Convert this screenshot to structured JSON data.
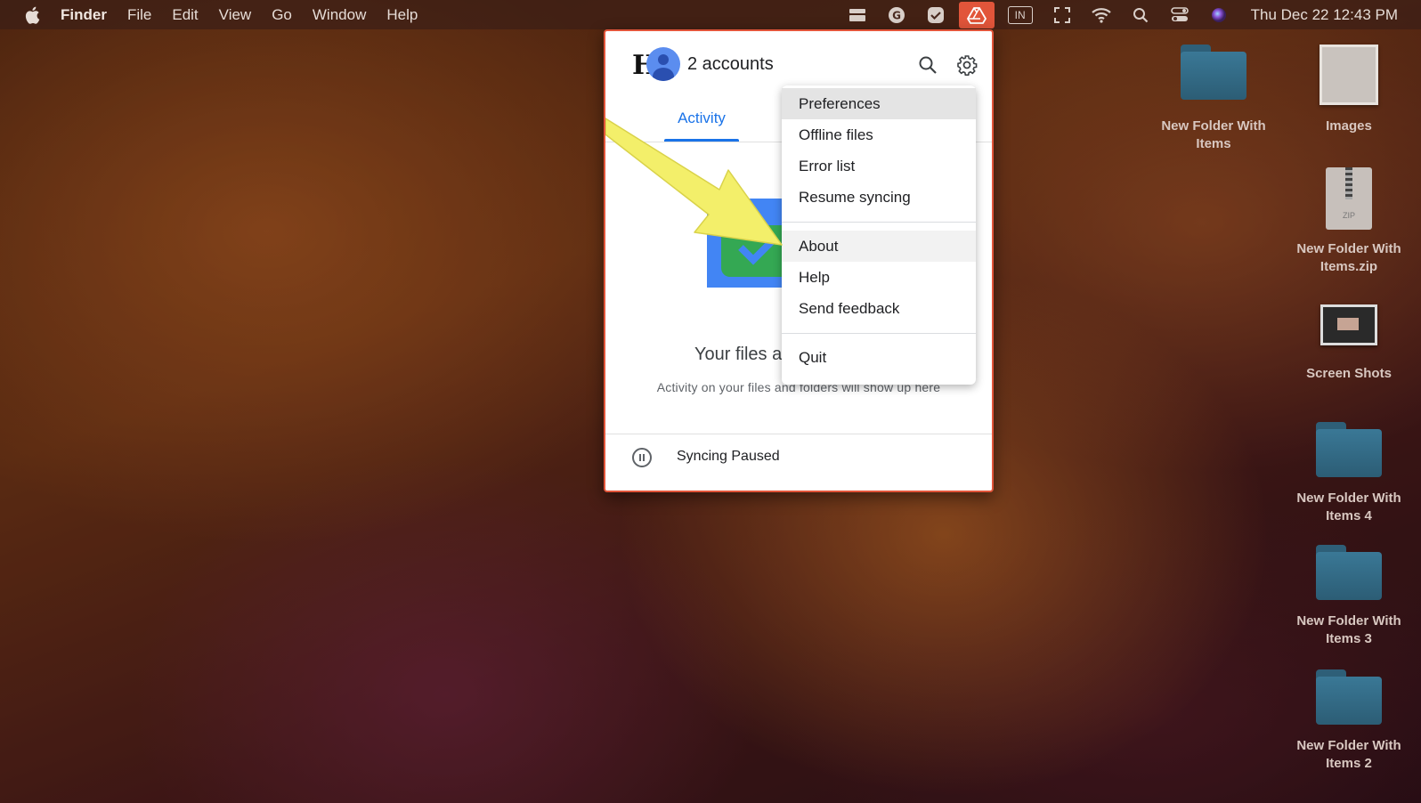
{
  "menubar": {
    "app_name": "Finder",
    "menus": [
      "File",
      "Edit",
      "View",
      "Go",
      "Window",
      "Help"
    ],
    "clock": "Thu Dec 22  12:43 PM",
    "status_icons": [
      "stack-icon",
      "grammarly-icon",
      "task-check-icon",
      "google-drive-icon",
      "input-source-icon",
      "fullscreen-icon",
      "wifi-icon",
      "spotlight-icon",
      "control-center-icon",
      "siri-icon"
    ],
    "input_source": "IN"
  },
  "drive_panel": {
    "accounts_label": "2 accounts",
    "tab_activity": "Activity",
    "empty_title": "Your files a",
    "empty_subtitle": "Activity on your files and folders will show up here",
    "sync_status": "Syncing Paused"
  },
  "settings_menu": {
    "items_group1": [
      "Preferences",
      "Offline files",
      "Error list",
      "Resume syncing"
    ],
    "items_group2": [
      "About",
      "Help",
      "Send feedback"
    ],
    "items_group3": [
      "Quit"
    ]
  },
  "desktop_icons": [
    {
      "label": "New Folder With Items"
    },
    {
      "label": "Images"
    },
    {
      "label": "New Folder With Items.zip"
    },
    {
      "label": "Screen Shots"
    },
    {
      "label": "New Folder With Items 4"
    },
    {
      "label": "New Folder With Items 3"
    },
    {
      "label": "New Folder With Items 2"
    }
  ],
  "colors": {
    "accent_blue": "#1a73e8",
    "highlight_orange": "#e2553a",
    "annotation_yellow": "#f3ef6a"
  }
}
